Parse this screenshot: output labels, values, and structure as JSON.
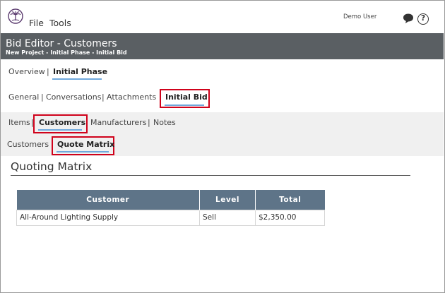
{
  "menu": {
    "file": "File",
    "tools": "Tools"
  },
  "user": {
    "name": "Demo User"
  },
  "icons": {
    "logo": "palm-tree-icon",
    "chat": "chat-bubble-icon",
    "help": "help-icon",
    "help_glyph": "?"
  },
  "header": {
    "title": "Bid Editor - Customers",
    "breadcrumb": "New Project - Initial Phase - Initial Bid"
  },
  "nav_level1": {
    "items": [
      "Overview",
      "Initial Phase"
    ],
    "active": "Initial Phase",
    "separator": "|"
  },
  "nav_level2": {
    "items": [
      "General",
      "Conversations",
      "Attachments",
      "Initial Bid"
    ],
    "active": "Initial Bid",
    "separator": "|"
  },
  "nav_level3": {
    "items": [
      "Items",
      "Customers",
      "Manufacturers",
      "Notes"
    ],
    "active": "Customers",
    "separator": "|"
  },
  "nav_level4": {
    "items": [
      "Customers",
      "Quote Matrix"
    ],
    "active": "Quote Matrix"
  },
  "section": {
    "title": "Quoting Matrix"
  },
  "table": {
    "headers": [
      "Customer",
      "Level",
      "Total"
    ],
    "rows": [
      [
        "All-Around Lighting Supply",
        "Sell",
        "$2,350.00"
      ]
    ]
  },
  "colors": {
    "title_bar": "#5a5f63",
    "table_header": "#5e7488",
    "active_underline": "#6fa8dc",
    "highlight_box": "#d0021b"
  }
}
